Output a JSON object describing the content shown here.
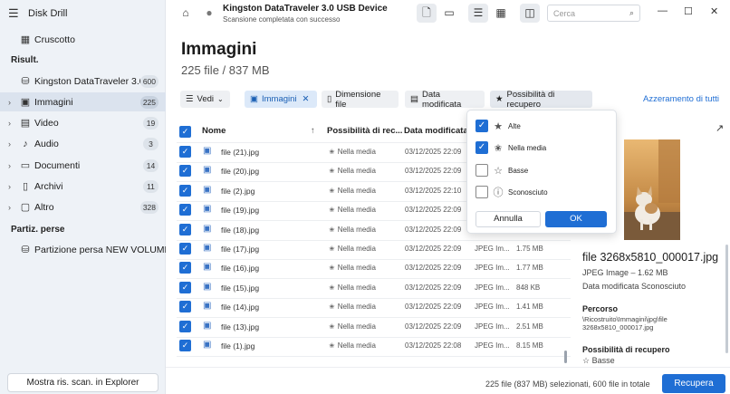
{
  "app": {
    "title": "Disk Drill"
  },
  "sidebar": {
    "dashboard": "Cruscotto",
    "results_heading": "Risult.",
    "device": {
      "label": "Kingston DataTraveler 3.0...",
      "count": "600"
    },
    "categories": [
      {
        "label": "Immagini",
        "count": "225",
        "icon": "image-icon"
      },
      {
        "label": "Video",
        "count": "19",
        "icon": "film-icon"
      },
      {
        "label": "Audio",
        "count": "3",
        "icon": "music-note-icon"
      },
      {
        "label": "Documenti",
        "count": "14",
        "icon": "document-icon"
      },
      {
        "label": "Archivi",
        "count": "11",
        "icon": "archive-icon"
      },
      {
        "label": "Altro",
        "count": "328",
        "icon": "other-files-icon"
      }
    ],
    "lost_heading": "Partiz. perse",
    "lost_partition": "Partizione persa NEW VOLUME...",
    "show_explorer": "Mostra ris. scan. in Explorer"
  },
  "topbar": {
    "device_title": "Kingston DataTraveler 3.0 USB Device",
    "status": "Scansione completata con successo",
    "search_placeholder": "Cerca"
  },
  "main": {
    "title": "Immagini",
    "subtitle": "225 file / 837 MB",
    "filters": {
      "views": "Vedi",
      "images_chip": "Immagini",
      "file_size": "Dimensione file",
      "date_modified": "Data modificata",
      "recovery_chance": "Possibilità di recupero",
      "reset_all": "Azzeramento di tutti"
    },
    "columns": {
      "name": "Nome",
      "recovery": "Possibilità di rec...",
      "date": "Data modificata"
    },
    "rows": [
      {
        "name": "file (21).jpg",
        "recovery": "Nella media",
        "date": "03/12/2025 22:09",
        "type": "",
        "size": ""
      },
      {
        "name": "file (20).jpg",
        "recovery": "Nella media",
        "date": "03/12/2025 22:09",
        "type": "",
        "size": ""
      },
      {
        "name": "file (2).jpg",
        "recovery": "Nella media",
        "date": "03/12/2025 22:10",
        "type": "",
        "size": ""
      },
      {
        "name": "file (19).jpg",
        "recovery": "Nella media",
        "date": "03/12/2025 22:09",
        "type": "",
        "size": ""
      },
      {
        "name": "file (18).jpg",
        "recovery": "Nella media",
        "date": "03/12/2025 22:09",
        "type": "",
        "size": ""
      },
      {
        "name": "file (17).jpg",
        "recovery": "Nella media",
        "date": "03/12/2025 22:09",
        "type": "JPEG Im...",
        "size": "1.75 MB"
      },
      {
        "name": "file (16).jpg",
        "recovery": "Nella media",
        "date": "03/12/2025 22:09",
        "type": "JPEG Im...",
        "size": "1.77 MB"
      },
      {
        "name": "file (15).jpg",
        "recovery": "Nella media",
        "date": "03/12/2025 22:09",
        "type": "JPEG Im...",
        "size": "848 KB"
      },
      {
        "name": "file (14).jpg",
        "recovery": "Nella media",
        "date": "03/12/2025 22:09",
        "type": "JPEG Im...",
        "size": "1.41 MB"
      },
      {
        "name": "file (13).jpg",
        "recovery": "Nella media",
        "date": "03/12/2025 22:09",
        "type": "JPEG Im...",
        "size": "2.51 MB"
      },
      {
        "name": "file (1).jpg",
        "recovery": "Nella media",
        "date": "03/12/2025 22:08",
        "type": "JPEG Im...",
        "size": "8.15 MB"
      }
    ]
  },
  "popup": {
    "options": [
      {
        "label": "Alte",
        "checked": true,
        "icon": "star-filled-icon"
      },
      {
        "label": "Nella media",
        "checked": true,
        "icon": "star-half-icon"
      },
      {
        "label": "Basse",
        "checked": false,
        "icon": "star-outline-icon"
      },
      {
        "label": "Sconosciuto",
        "checked": false,
        "icon": "question-circle-icon"
      }
    ],
    "cancel": "Annulla",
    "ok": "OK"
  },
  "preview": {
    "filename": "file 3268x5810_000017.jpg",
    "meta": "JPEG Image – 1.62 MB",
    "modified": "Data modificata Sconosciuto",
    "path_heading": "Percorso",
    "path": "\\Ricostruito\\Immagini\\jpg\\file 3268x5810_000017.jpg",
    "recovery_heading": "Possibilità di recupero",
    "recovery_value": "Basse"
  },
  "footer": {
    "summary": "225 file (837 MB) selezionati, 600 file in totale",
    "recover": "Recupera"
  },
  "colors": {
    "accent": "#1f6ed4",
    "sidebar_bg": "#eef2f7"
  }
}
